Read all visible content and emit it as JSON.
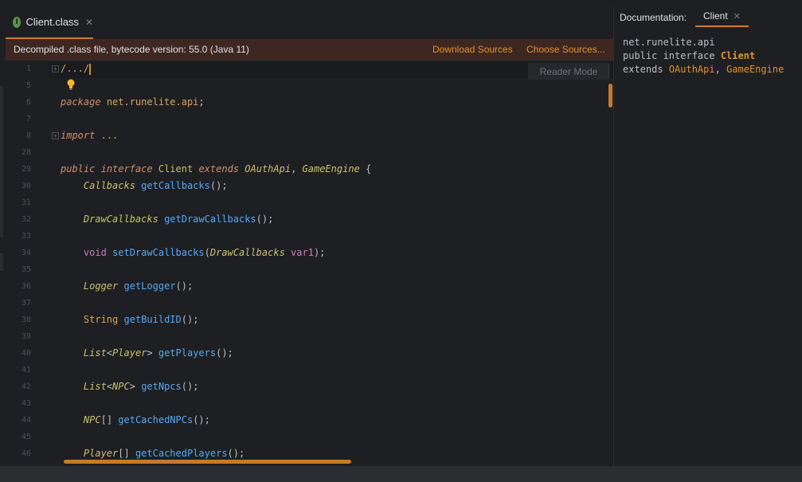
{
  "editor_tab": {
    "icon_letter": "I",
    "label": "Client.class",
    "close": "✕"
  },
  "banner": {
    "message": "Decompiled .class file, bytecode version: 55.0 (Java 11)",
    "download_sources": "Download Sources",
    "choose_sources": "Choose Sources..."
  },
  "editor": {
    "reader_mode": "Reader Mode",
    "line_numbers": [
      "1",
      "5",
      "6",
      "7",
      "8",
      "28",
      "29",
      "30",
      "31",
      "32",
      "33",
      "34",
      "35",
      "36",
      "37",
      "38",
      "39",
      "40",
      "41",
      "42",
      "43",
      "44",
      "45",
      "46"
    ],
    "code": {
      "collapsed_header": "/.../",
      "package_kw": "package",
      "package_name": "net.runelite.api",
      "import_kw": "import",
      "import_ellipsis": "...",
      "public_kw": "public",
      "interface_kw": "interface",
      "class_name": "Client",
      "extends_kw": "extends",
      "oauth": "OAuthApi",
      "game_engine": "GameEngine",
      "l30_type": "Callbacks",
      "l30_fn": "getCallbacks",
      "l32_type": "DrawCallbacks",
      "l32_fn": "getDrawCallbacks",
      "l34_type": "void",
      "l34_fn": "setDrawCallbacks",
      "l34_ptype": "DrawCallbacks",
      "l34_pname": "var1",
      "l36_type": "Logger",
      "l36_fn": "getLogger",
      "l38_type": "String",
      "l38_fn": "getBuildID",
      "l40_type": "List",
      "l40_gen": "Player",
      "l40_fn": "getPlayers",
      "l42_type": "List",
      "l42_gen": "NPC",
      "l42_fn": "getNpcs",
      "l44_type": "NPC",
      "l44_fn": "getCachedNPCs",
      "l46_type": "Player",
      "l46_fn": "getCachedPlayers"
    }
  },
  "doc_panel": {
    "title": "Documentation:",
    "tab_label": "Client",
    "close": "✕",
    "package": "net.runelite.api",
    "decl_prefix": "public interface",
    "decl_name": "Client",
    "extends_kw": "extends",
    "extends_a": "OAuthApi",
    "extends_b": "GameEngine"
  },
  "colors": {
    "accent": "#d17d2a",
    "banner_bg": "#3e2721",
    "link": "#e0922f"
  },
  "icons": [
    "interface-icon",
    "close-icon",
    "lightbulb-icon",
    "fold-icon"
  ]
}
